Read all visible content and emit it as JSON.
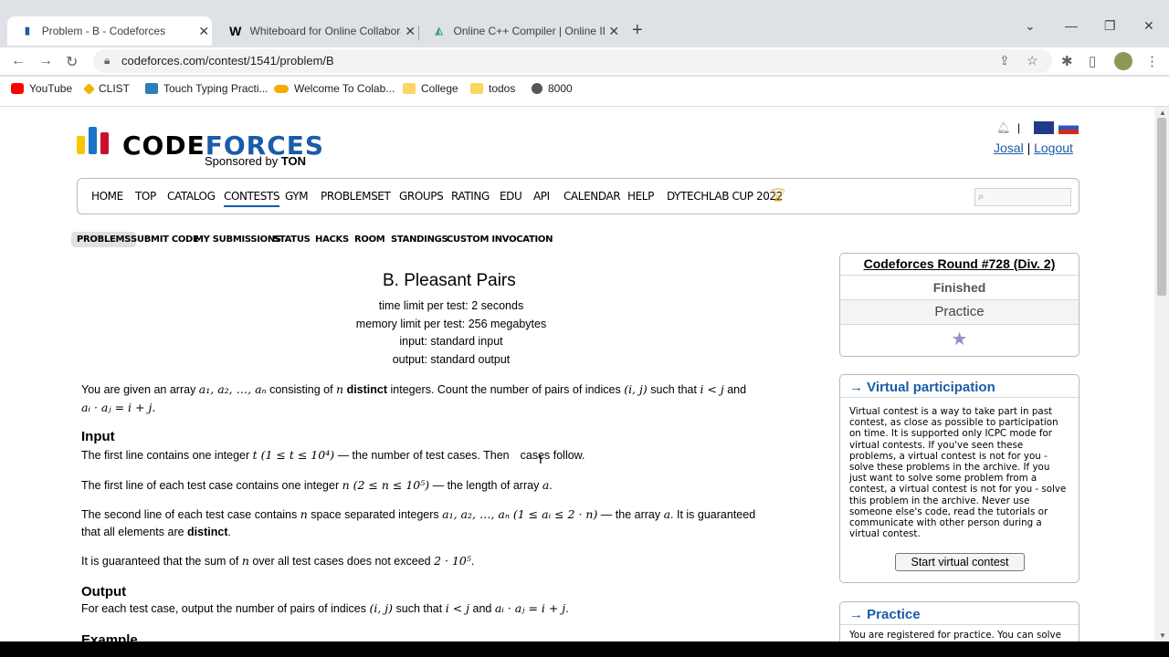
{
  "browser": {
    "tabs": [
      {
        "title": "Problem - B - Codeforces",
        "favicon": "codeforces-icon",
        "active": true
      },
      {
        "title": "Whiteboard for Online Collabora",
        "favicon": "W",
        "active": false
      },
      {
        "title": "Online C++ Compiler | Online IDE",
        "favicon": "compiler-icon",
        "active": false
      }
    ],
    "url": "codeforces.com/contest/1541/problem/B",
    "bookmarks": [
      {
        "label": "YouTube",
        "icon_color": "#ff0000"
      },
      {
        "label": "CLIST",
        "icon_color": "#f0b400"
      },
      {
        "label": "Touch Typing Practi...",
        "icon_color": "#2c7fb8"
      },
      {
        "label": "Welcome To Colab...",
        "icon_color": "#f9ab00"
      },
      {
        "label": "College",
        "icon_color": "#fcd663"
      },
      {
        "label": "todos",
        "icon_color": "#fcd663"
      },
      {
        "label": "8000",
        "icon_color": "#555555"
      }
    ]
  },
  "header": {
    "logo_code": "CODE",
    "logo_forces": "FORCES",
    "sponsor_prefix": "Sponsored by ",
    "sponsor_name": "TON",
    "user": "Josal",
    "separator": "|",
    "logout": "Logout",
    "lang_separator": "|"
  },
  "menu": [
    "HOME",
    "TOP",
    "CATALOG",
    "CONTESTS",
    "GYM",
    "PROBLEMSET",
    "GROUPS",
    "RATING",
    "EDU",
    "API",
    "CALENDAR",
    "HELP",
    "DYTECHLAB CUP 2022"
  ],
  "submenu": [
    "PROBLEMS",
    "SUBMIT CODE",
    "MY SUBMISSIONS",
    "STATUS",
    "HACKS",
    "ROOM",
    "STANDINGS",
    "CUSTOM INVOCATION"
  ],
  "problem": {
    "title": "B. Pleasant Pairs",
    "time_limit": "time limit per test: 2 seconds",
    "memory_limit": "memory limit per test: 256 megabytes",
    "input": "input: standard input",
    "output": "output: standard output",
    "statement_1a": "You are given an array ",
    "statement_1b": " consisting of ",
    "statement_1c": " distinct",
    "statement_1d": " integers. Count the number of pairs of indices ",
    "statement_1e": " such that ",
    "statement_1f": " and",
    "statement_2": "aᵢ · aⱼ = i + j.",
    "math_array": "a₁, a₂, …, aₙ",
    "math_n": "n",
    "math_ij": "(i, j)",
    "math_iltj": "i < j",
    "input_header": "Input",
    "input_p1a": "The first line contains one integer ",
    "input_p1_math": "t (1 ≤ t ≤ 10⁴)",
    "input_p1b": " — the number of test cases. Then ",
    "input_p1c": " cases follow.",
    "input_p2a": "The first line of each test case contains one integer ",
    "input_p2_math": "n (2 ≤ n ≤ 10⁵)",
    "input_p2b": " — the length of array ",
    "math_a": "a",
    "input_p3a": "The second line of each test case contains ",
    "input_p3b": " space separated integers ",
    "input_p3_math": "a₁, a₂, …, aₙ (1 ≤ aᵢ ≤ 2 · n)",
    "input_p3c": " — the array ",
    "input_p3d": ". It is guaranteed",
    "input_p3e": "that all elements are ",
    "input_p3f": "distinct",
    "input_p3g": ".",
    "input_p4a": "It is guaranteed that the sum of ",
    "input_p4b": " over all test cases does not exceed ",
    "input_p4_math": "2 · 10⁵",
    "output_header": "Output",
    "output_p1a": "For each test case, output the number of pairs of indices ",
    "output_p1b": " such that ",
    "output_p1c": " and ",
    "output_math": "aᵢ · aⱼ = i + j",
    "example_header": "Example"
  },
  "sidebar": {
    "round_title": "Codeforces Round #728 (Div. 2)",
    "status": "Finished",
    "mode": "Practice",
    "vp_title": "→ Virtual participation",
    "vp_text": "Virtual contest is a way to take part in past contest, as close as possible to participation on time. It is supported only ICPC mode for virtual contests. If you've seen these problems, a virtual contest is not for you - solve these problems in the archive. If you just want to solve some problem from a contest, a virtual contest is not for you - solve this problem in the archive. Never use someone else's code, read the tutorials or communicate with other person during a virtual contest.",
    "vp_button": "Start virtual contest",
    "practice_title": "→ Practice",
    "practice_text": "You are registered for practice. You can solve"
  },
  "colors": {
    "link_blue": "#1a5ca8",
    "logo_yellow": "#f5c800",
    "logo_blue": "#1a73c8",
    "logo_red": "#c8102e"
  }
}
